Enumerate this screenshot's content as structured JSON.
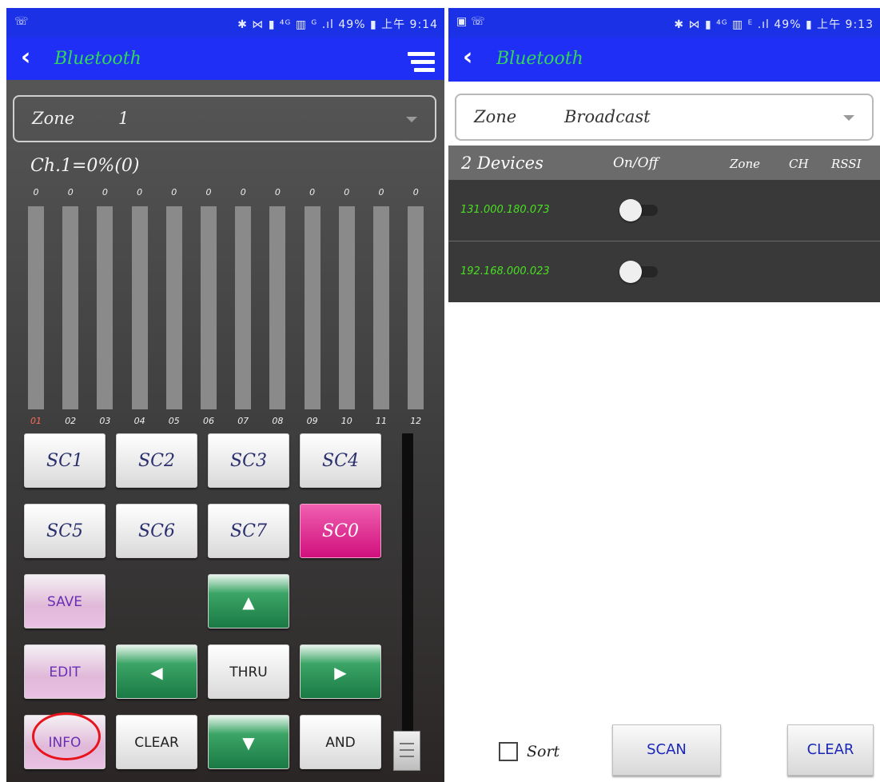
{
  "left": {
    "status": {
      "left": "☏",
      "right": "✱ ⋈ ▮ ⁴ᴳ ▥ ᴳ .ıl 49% ▮ 上午 9:14"
    },
    "title": "Bluetooth",
    "zone": {
      "label": "Zone",
      "value": "1"
    },
    "channel_readout": "Ch.1=0%(0)",
    "sliders": [
      {
        "value": "0",
        "number": "01"
      },
      {
        "value": "0",
        "number": "02"
      },
      {
        "value": "0",
        "number": "03"
      },
      {
        "value": "0",
        "number": "04"
      },
      {
        "value": "0",
        "number": "05"
      },
      {
        "value": "0",
        "number": "06"
      },
      {
        "value": "0",
        "number": "07"
      },
      {
        "value": "0",
        "number": "08"
      },
      {
        "value": "0",
        "number": "09"
      },
      {
        "value": "0",
        "number": "10"
      },
      {
        "value": "0",
        "number": "11"
      },
      {
        "value": "0",
        "number": "12"
      }
    ],
    "buttons": {
      "sc1": "SC1",
      "sc2": "SC2",
      "sc3": "SC3",
      "sc4": "SC4",
      "sc5": "SC5",
      "sc6": "SC6",
      "sc7": "SC7",
      "sc0": "SC0",
      "save": "SAVE",
      "up": "▲",
      "edit": "EDIT",
      "left": "◀",
      "thru": "THRU",
      "right": "▶",
      "info": "INFO",
      "clear": "CLEAR",
      "down": "▼",
      "and": "AND"
    }
  },
  "right": {
    "status": {
      "left": "▣ ☏",
      "right": "✱ ⋈ ▮ ⁴ᴳ ▥ ᴱ .ıl 49% ▮ 上午 9:13"
    },
    "title": "Bluetooth",
    "zone": {
      "label": "Zone",
      "value": "Broadcast"
    },
    "table_header": {
      "devices": "2 Devices",
      "onoff": "On/Off",
      "zone": "Zone",
      "ch": "CH",
      "rssi": "RSSI"
    },
    "devices": [
      {
        "address": "131.000.180.073",
        "on": false
      },
      {
        "address": "192.168.000.023",
        "on": false
      }
    ],
    "sort_label": "Sort",
    "scan_label": "SCAN",
    "clear_label": "CLEAR"
  },
  "colors": {
    "appbar": "#1f2ff5",
    "title": "#33d65a",
    "device_text": "#49e021",
    "sc0": "#d0107e",
    "highlight": "#e8141b"
  }
}
